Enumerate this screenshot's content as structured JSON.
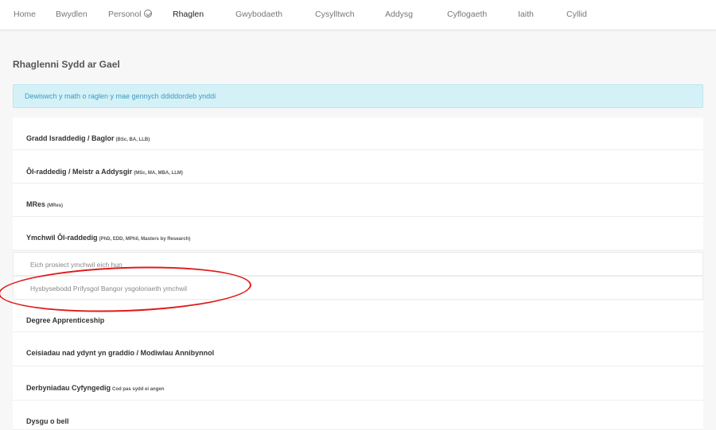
{
  "nav": {
    "items": [
      {
        "label": "Home"
      },
      {
        "label": "Bwydlen"
      },
      {
        "label": "Personol"
      },
      {
        "label": "Rhaglen"
      },
      {
        "label": "Gwybodaeth"
      },
      {
        "label": "Cysylltwch"
      },
      {
        "label": "Addysg"
      },
      {
        "label": "Cyflogaeth"
      },
      {
        "label": "Iaith"
      },
      {
        "label": "Cyllid"
      }
    ],
    "active": "Rhaglen",
    "personal_icon": "check-circle-icon"
  },
  "page": {
    "title": "Rhaglenni Sydd ar Gael",
    "alert": "Dewiswch y math o raglen y mae gennych ddiddordeb ynddi"
  },
  "programmes": [
    {
      "label": "Gradd Israddedig / Baglor",
      "note": "(BSc, BA, LLB)"
    },
    {
      "label": "Ôl-raddedig / Meistr a Addysgir",
      "note": "(MSc, MA, MBA, LLM)"
    },
    {
      "label": "MRes",
      "note": "(MRes)"
    },
    {
      "label": "Ymchwil Ôl-raddedig",
      "note": "(PhD, EDD, MPhil, Masters by Research)"
    },
    {
      "label": "Degree Apprenticeship",
      "note": ""
    },
    {
      "label": "Ceisiadau nad ydynt yn graddio / Modiwlau Annibynnol",
      "note": ""
    },
    {
      "label": "Derbyniadau Cyfyngedig",
      "note": "Cod pas sydd ei angen"
    },
    {
      "label": "Dysgu o bell",
      "note": ""
    }
  ],
  "research_options": [
    {
      "label": "Eich prosiect ymchwil eich hun"
    },
    {
      "label": "Hysbysebodd Prifysgol Bangor ysgoloriaeth ymchwil"
    }
  ],
  "colors": {
    "alert_bg": "#d5f1f8",
    "alert_text": "#3a9bbd",
    "highlight": "#e11a1a"
  }
}
